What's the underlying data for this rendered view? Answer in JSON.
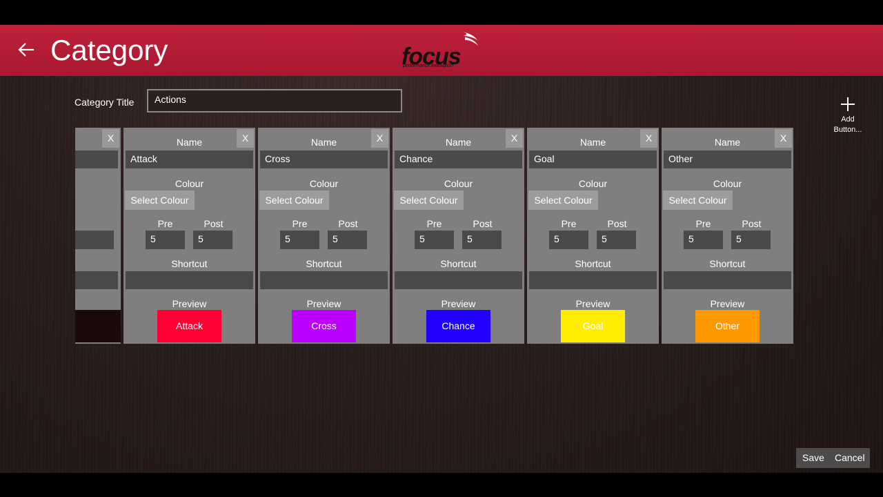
{
  "header": {
    "back_icon": "arrow-left-icon",
    "title": "Category",
    "logo": {
      "word": "focus",
      "tagline": "performance innovation"
    }
  },
  "category": {
    "label": "Category Title",
    "value": "Actions"
  },
  "add_button": {
    "icon": "plus-icon",
    "label": "Add Button..."
  },
  "card_labels": {
    "name": "Name",
    "colour": "Colour",
    "select_colour": "Select Colour",
    "pre": "Pre",
    "post": "Post",
    "shortcut": "Shortcut",
    "preview": "Preview",
    "close": "X"
  },
  "cards": [
    {
      "name": "Attack",
      "pre": "5",
      "post": "5",
      "shortcut": "",
      "color": "#ff0033"
    },
    {
      "name": "Cross",
      "pre": "5",
      "post": "5",
      "shortcut": "",
      "color": "#bb00ff"
    },
    {
      "name": "Chance",
      "pre": "5",
      "post": "5",
      "shortcut": "",
      "color": "#2200ff"
    },
    {
      "name": "Goal",
      "pre": "5",
      "post": "5",
      "shortcut": "",
      "color": "#ffee00"
    },
    {
      "name": "Other",
      "pre": "5",
      "post": "5",
      "shortcut": "",
      "color": "#ff9900"
    }
  ],
  "partial_card": {
    "post": "ost",
    "color": "#1a0a0a"
  },
  "footer": {
    "save": "Save",
    "cancel": "Cancel"
  }
}
